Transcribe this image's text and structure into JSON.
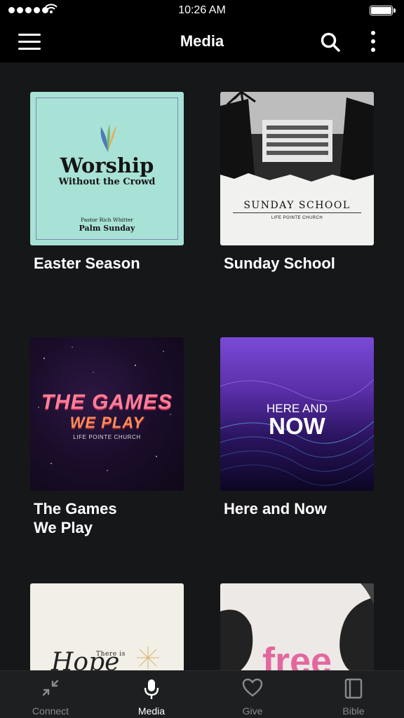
{
  "status_bar": {
    "time": "10:26 AM"
  },
  "app_bar": {
    "title": "Media"
  },
  "media_items": [
    {
      "label": "Easter Season",
      "art": {
        "title": "Worship",
        "subtitle": "Without the Crowd",
        "pastor": "Pastor Rich Whitter",
        "sermon": "Palm Sunday"
      }
    },
    {
      "label": "Sunday School",
      "art": {
        "title": "SUNDAY SCHOOL",
        "church": "LIFE POINTE CHURCH"
      }
    },
    {
      "label": "The Games\nWe Play",
      "art": {
        "line1": "THE GAMES",
        "line2": "WE PLAY",
        "church": "LIFE POINTE CHURCH"
      }
    },
    {
      "label": "Here and Now",
      "art": {
        "line1": "HERE AND",
        "line2": "NOW"
      }
    },
    {
      "label": "",
      "art": {
        "line1": "There is",
        "line2": "Hope"
      }
    },
    {
      "label": "",
      "art": {
        "line1": "free"
      }
    }
  ],
  "tab_bar": {
    "tabs": [
      {
        "label": "Connect",
        "icon": "connect-icon",
        "active": false
      },
      {
        "label": "Media",
        "icon": "microphone-icon",
        "active": true
      },
      {
        "label": "Give",
        "icon": "heart-icon",
        "active": false
      },
      {
        "label": "Bible",
        "icon": "book-icon",
        "active": false
      }
    ]
  }
}
